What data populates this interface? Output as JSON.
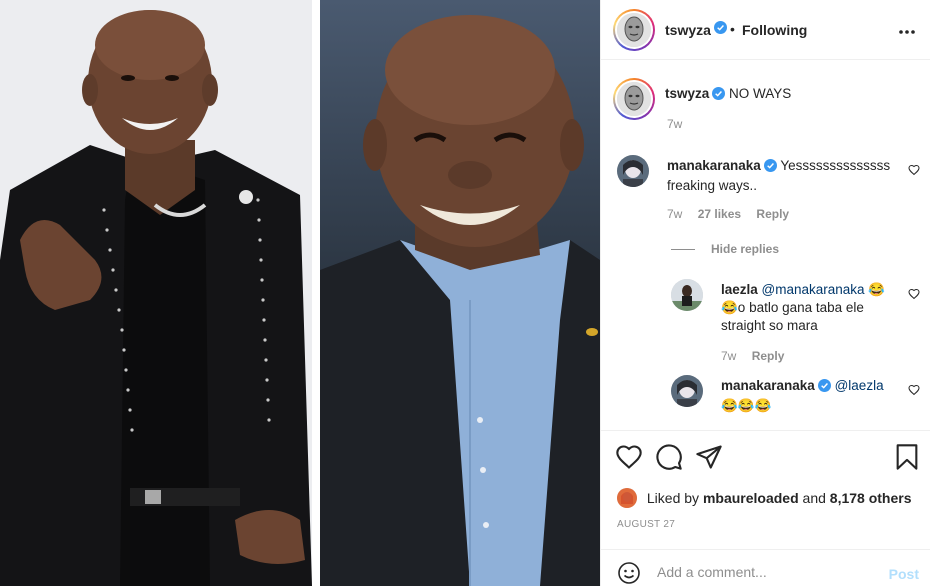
{
  "post": {
    "author": "tswyza",
    "separator": "•",
    "follow_status": "Following",
    "more_icon": "more-horizontal-icon"
  },
  "caption": {
    "username": "tswyza",
    "text": "NO WAYS",
    "time": "7w"
  },
  "comments": [
    {
      "username": "manakaranaka",
      "verified": true,
      "text_line1": "Yessssssssssssss",
      "text_line2": "freaking ways..",
      "time": "7w",
      "likes": "27 likes",
      "reply": "Reply"
    }
  ],
  "hide_replies": "Hide replies",
  "replies": [
    {
      "username": "laezla",
      "mention": "@manakaranaka",
      "emoji_after_mention": "😂",
      "text_line2": "😂o batlo gana taba ele",
      "text_line3": "straight so mara",
      "time": "7w",
      "reply": "Reply"
    },
    {
      "username": "manakaranaka",
      "verified": true,
      "mention": "@laezla",
      "text_line2": "😂😂😂"
    }
  ],
  "actions": {
    "like_icon": "heart-icon",
    "comment_icon": "comment-icon",
    "share_icon": "send-icon",
    "save_icon": "bookmark-icon"
  },
  "likes": {
    "prefix": "Liked by",
    "user": "mbaureloaded",
    "middle": "and",
    "count": "8,178 others"
  },
  "date": "AUGUST 27",
  "add_comment": {
    "placeholder": "Add a comment...",
    "post_label": "Post",
    "emoji_icon": "smiley-icon"
  },
  "colors": {
    "verified": "#3897f0",
    "mention": "#00376b",
    "post_disabled": "#b2dffc",
    "muted": "#8e8e8e"
  }
}
